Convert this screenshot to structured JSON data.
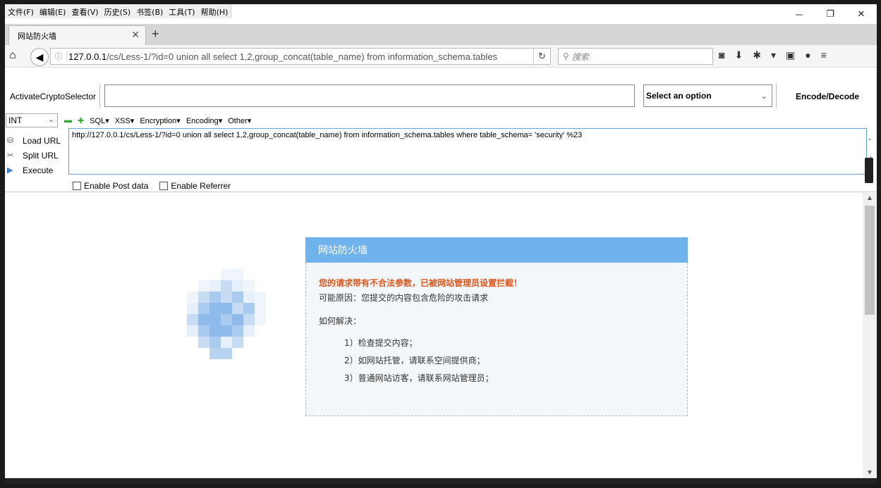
{
  "menubar": [
    "文件(F)",
    "编辑(E)",
    "查看(V)",
    "历史(S)",
    "书签(B)",
    "工具(T)",
    "帮助(H)"
  ],
  "tab": {
    "title": "网站防火墙"
  },
  "navbar": {
    "url_host": "127.0.0.1",
    "url_path": "/cs/Less-1/?id=0 union all select 1,2,group_concat(table_name)  from information_schema.tables",
    "search_placeholder": "搜索"
  },
  "hackbar": {
    "acs_label": "ActivateCryptoSelector",
    "select_option": "Select an option",
    "encode_decode": "Encode/Decode",
    "int_value": "INT",
    "menu": [
      "SQL",
      "XSS",
      "Encryption",
      "Encoding",
      "Other"
    ],
    "load_url": "Load URL",
    "split_url": "Split URL",
    "execute": "Execute",
    "url_value": "http://127.0.0.1/cs/Less-1/?id=0 union all select 1,2,group_concat(table_name)  from information_schema.tables where table_schema= 'security' %23",
    "enable_post": "Enable Post data",
    "enable_referrer": "Enable Referrer"
  },
  "firewall": {
    "title": "网站防火墙",
    "alert": "您的请求带有不合法参数，已被网站管理员设置拦截！",
    "reason": "可能原因：您提交的内容包含危险的攻击请求",
    "how": "如何解决：",
    "steps": [
      "1）检查提交内容；",
      "2）如网站托管，请联系空间提供商；",
      "3）普通网站访客，请联系网站管理员；"
    ]
  },
  "colors": {
    "header": "#6fb2ec",
    "alert": "#e0571e",
    "body_bg": "#f3f7fa"
  }
}
